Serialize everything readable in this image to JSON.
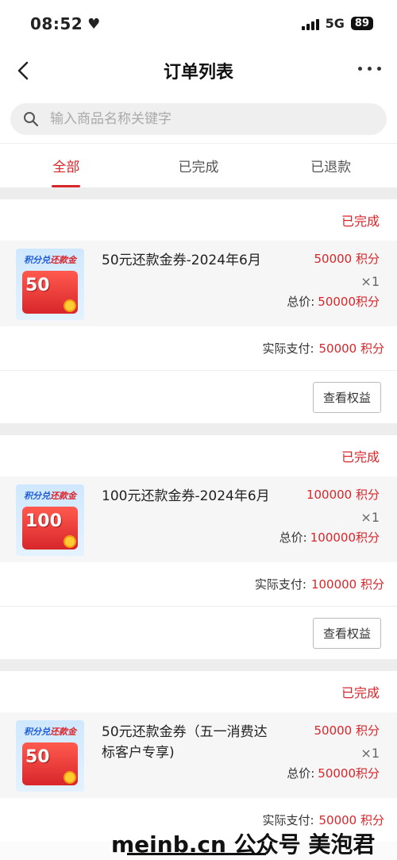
{
  "status_bar": {
    "time": "08:52",
    "heart": "♥",
    "network": "5G",
    "battery": "89"
  },
  "nav": {
    "title": "订单列表"
  },
  "search": {
    "placeholder": "输入商品名称关键字"
  },
  "tabs": [
    {
      "label": "全部",
      "active": true
    },
    {
      "label": "已完成",
      "active": false
    },
    {
      "label": "已退款",
      "active": false
    }
  ],
  "orders": [
    {
      "status": "已完成",
      "thumb_tag_a": "积分兑",
      "thumb_tag_b": "还款金",
      "thumb_amount": "50",
      "name": "50元还款金券-2024年6月",
      "price": "50000 积分",
      "qty": "×1",
      "total_label": "总价:",
      "total_value": "50000积分",
      "pay_label": "实际支付:",
      "pay_value": "50000 积分",
      "button": "查看权益"
    },
    {
      "status": "已完成",
      "thumb_tag_a": "积分兑",
      "thumb_tag_b": "还款金",
      "thumb_amount": "100",
      "name": "100元还款金券-2024年6月",
      "price": "100000 积分",
      "qty": "×1",
      "total_label": "总价:",
      "total_value": "100000积分",
      "pay_label": "实际支付:",
      "pay_value": "100000 积分",
      "button": "查看权益"
    },
    {
      "status": "已完成",
      "thumb_tag_a": "积分兑",
      "thumb_tag_b": "还款金",
      "thumb_amount": "50",
      "name": "50元还款金券（五一消费达标客户专享)",
      "price": "50000 积分",
      "qty": "×1",
      "total_label": "总价:",
      "total_value": "50000积分",
      "pay_label": "实际支付:",
      "pay_value": "50000 积分"
    }
  ],
  "watermark": "meinb.cn  公众号 美泡君",
  "colors": {
    "accent": "#d8262b",
    "background": "#ededed"
  }
}
